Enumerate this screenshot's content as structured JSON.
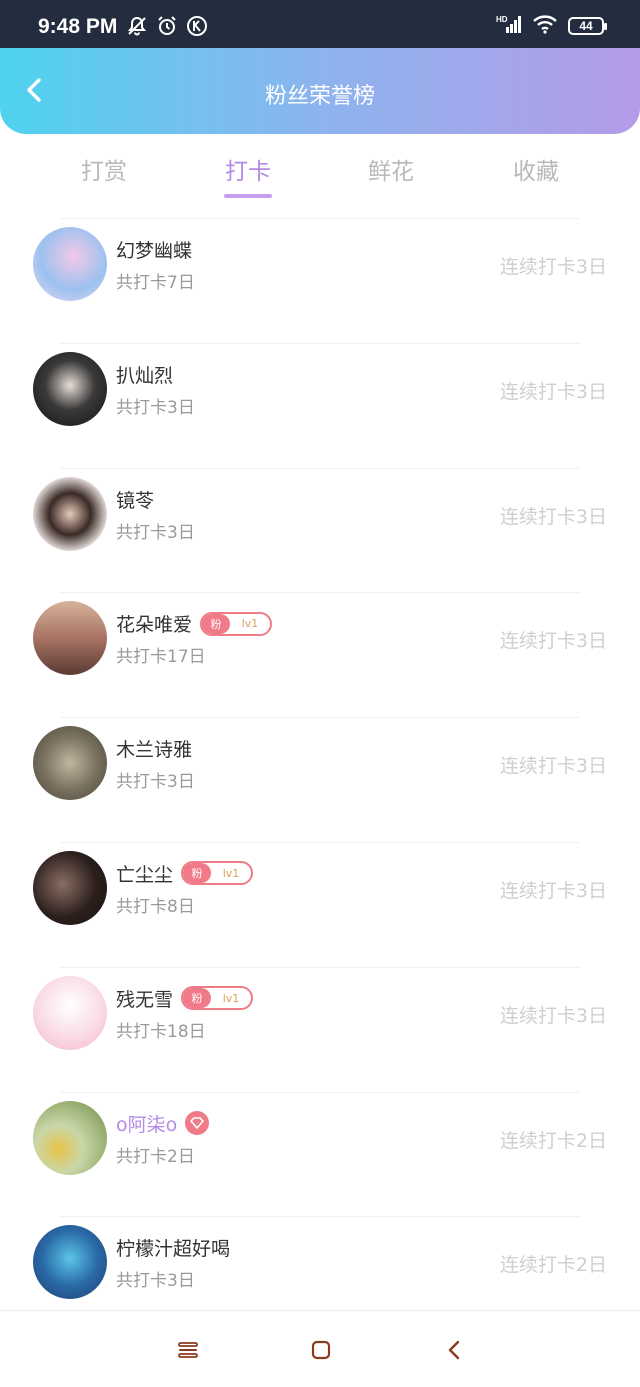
{
  "status_bar": {
    "time": "9:48 PM",
    "battery": "44"
  },
  "header": {
    "title": "粉丝荣誉榜"
  },
  "tabs": [
    {
      "label": "打赏"
    },
    {
      "label": "打卡",
      "active": true
    },
    {
      "label": "鲜花"
    },
    {
      "label": "收藏"
    }
  ],
  "rows": [
    {
      "name": "幻梦幽蝶",
      "total": "共打卡7日",
      "streak": "连续打卡3日",
      "avatar_colors": [
        "#f3c9e8",
        "#9cc1ef",
        "#e8d7f5"
      ]
    },
    {
      "name": "扒灿烈",
      "total": "共打卡3日",
      "streak": "连续打卡3日",
      "avatar_colors": [
        "#111111",
        "#3a3a3a",
        "#e8ddd5"
      ]
    },
    {
      "name": "镜苓",
      "total": "共打卡3日",
      "streak": "连续打卡3日",
      "avatar_colors": [
        "#f7f1ef",
        "#3a2a25",
        "#e6c9bb"
      ]
    },
    {
      "name": "花朵唯爱",
      "total": "共打卡17日",
      "streak": "连续打卡3日",
      "avatar_colors": [
        "#a87364",
        "#5b3b33",
        "#d7b29a"
      ],
      "badge": {
        "fan": "粉",
        "level": "lv1"
      }
    },
    {
      "name": "木兰诗雅",
      "total": "共打卡3日",
      "streak": "连续打卡3日",
      "avatar_colors": [
        "#7b7360",
        "#c0b7a2",
        "#4b4438"
      ]
    },
    {
      "name": "亡尘尘",
      "total": "共打卡8日",
      "streak": "连续打卡3日",
      "avatar_colors": [
        "#2b1f1c",
        "#8a6f64",
        "#1a1311"
      ],
      "badge": {
        "fan": "粉",
        "level": "lv1"
      }
    },
    {
      "name": "残无雪",
      "total": "共打卡18日",
      "streak": "连续打卡3日",
      "avatar_colors": [
        "#fbe2ea",
        "#f3b8c8",
        "#ffffff"
      ],
      "badge": {
        "fan": "粉",
        "level": "lv1"
      }
    },
    {
      "name": "o阿柒o",
      "total": "共打卡2日",
      "streak": "连续打卡2日",
      "avatar_colors": [
        "#6f8c43",
        "#e8c24a",
        "#c9d7a8"
      ],
      "vip": true,
      "name_color": "purple"
    },
    {
      "name": "柠檬汁超好喝",
      "total": "共打卡3日",
      "streak": "连续打卡2日",
      "avatar_colors": [
        "#1c3c6e",
        "#5cc5e8",
        "#2a6aa8"
      ]
    }
  ]
}
